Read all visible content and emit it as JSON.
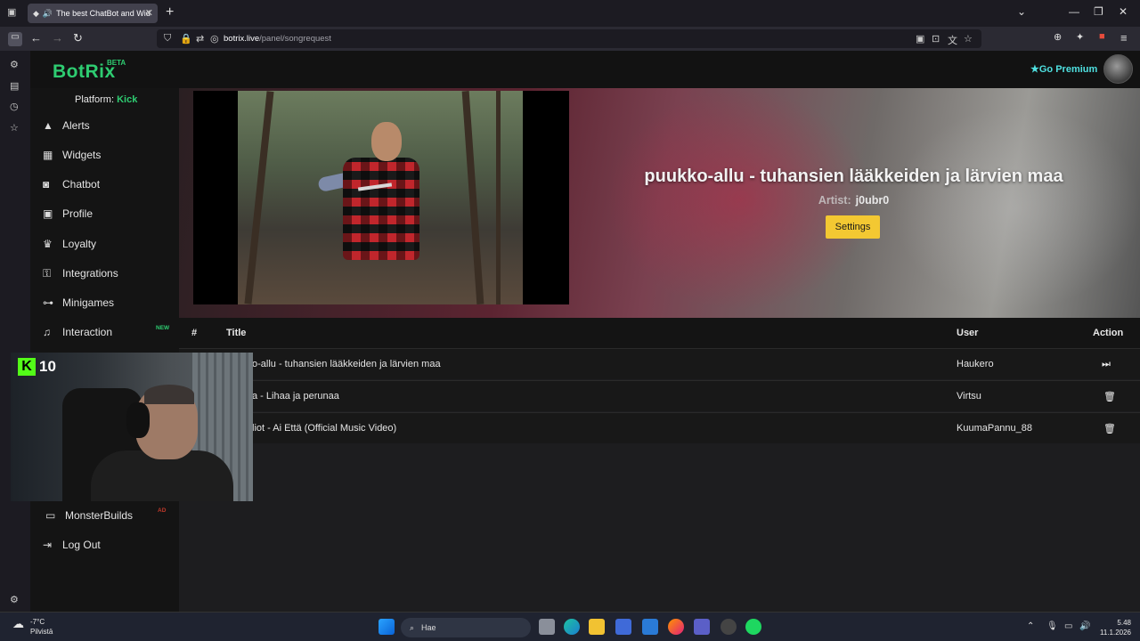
{
  "browser": {
    "tab_title": "The best ChatBot and Wid",
    "url_domain": "botrix.live",
    "url_path": "/panel/songrequest"
  },
  "app": {
    "logo": "BotRix",
    "beta": "BETA",
    "go_premium": "Go Premium",
    "platform_label": "Platform:",
    "platform_value": "Kick"
  },
  "sidebar": {
    "items": [
      {
        "label": "Alerts",
        "icon": "warning-icon"
      },
      {
        "label": "Widgets",
        "icon": "grid-icon"
      },
      {
        "label": "Chatbot",
        "icon": "robot-icon"
      },
      {
        "label": "Profile",
        "icon": "id-card-icon"
      },
      {
        "label": "Loyalty",
        "icon": "trophy-icon"
      },
      {
        "label": "Integrations",
        "icon": "plugin-icon"
      },
      {
        "label": "Minigames",
        "icon": "gamepad-icon"
      },
      {
        "label": "Interaction",
        "icon": "music-icon"
      },
      {
        "label": "MonsterBuilds",
        "icon": "laptop-icon"
      },
      {
        "label": "Log Out",
        "icon": "logout-icon"
      }
    ],
    "new_badge": "NEW",
    "ad_badge": "AD"
  },
  "now_playing": {
    "title": "puukko-allu - tuhansien lääkkeiden ja lärvien maa",
    "artist_label": "Artist:",
    "artist": "j0ubr0",
    "settings_label": "Settings"
  },
  "queue": {
    "headers": {
      "num": "#",
      "title": "Title",
      "user": "User",
      "action": "Action"
    },
    "rows": [
      {
        "title": "o-allu - tuhansien lääkkeiden ja lärvien maa",
        "user": "Haukero",
        "action": "skip-icon"
      },
      {
        "title": "a - Lihaa ja perunaa",
        "user": "Virtsu",
        "action": "trash-icon"
      },
      {
        "title": "liot - Ai Että (Official Music Video)",
        "user": "KuumaPannu_88",
        "action": "trash-icon"
      }
    ]
  },
  "stream_overlay": {
    "viewers": "10",
    "platform_glyph": "K"
  },
  "taskbar": {
    "temperature": "-7°C",
    "weather": "Pilvistä",
    "search_placeholder": "Hae",
    "time": "5.48",
    "date": "11.1.2026"
  },
  "colors": {
    "accent": "#2ecc71",
    "premium": "#4fe0e0",
    "settings_button": "#f3c832"
  }
}
